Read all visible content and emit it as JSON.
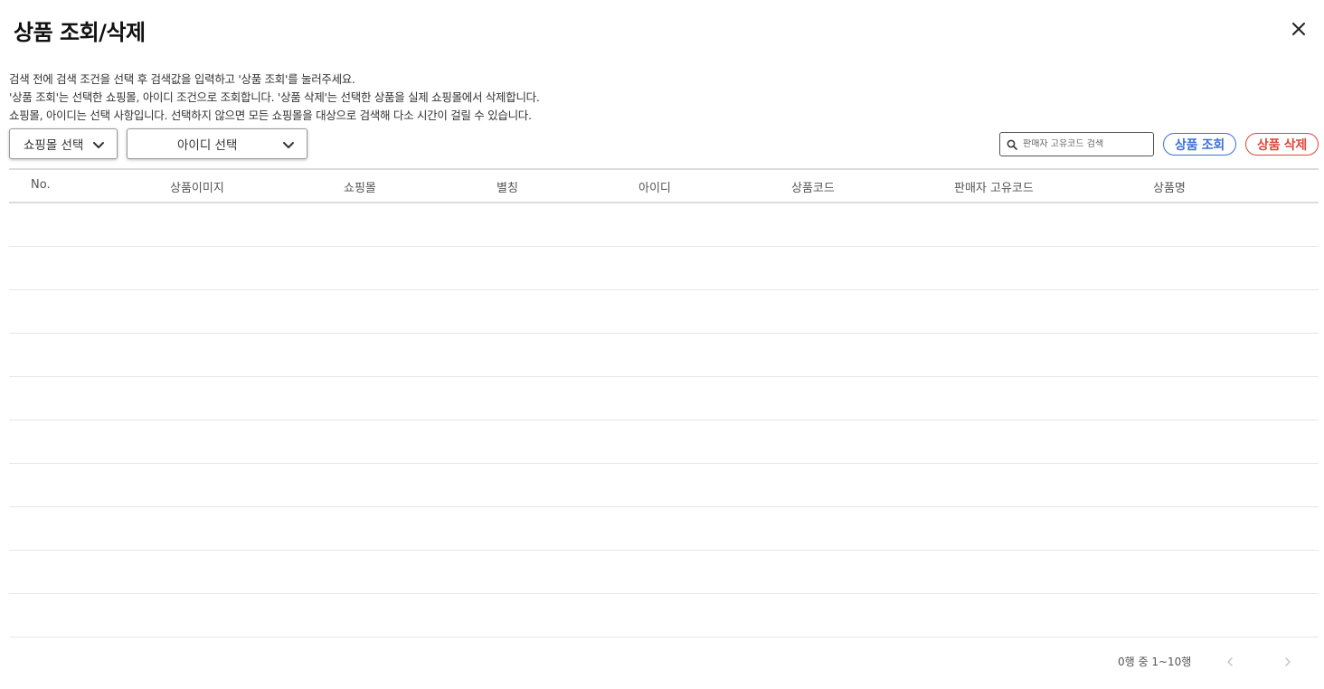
{
  "dialog": {
    "title": "상품 조회/삭제"
  },
  "instructions": [
    "검색 전에 검색 조건을 선택 후 검색값을 입력하고 '상품 조회'를 눌러주세요.",
    "'상품 조회'는 선택한 쇼핑몰, 아이디 조건으로 조회합니다. '상품 삭제'는 선택한 상품을 실제 쇼핑몰에서 삭제합니다.",
    "쇼핑몰, 아이디는 선택 사항입니다. 선택하지 않으면 모든 쇼핑몰을 대상으로 검색해 다소 시간이 걸릴 수 있습니다."
  ],
  "filters": {
    "mall_select": "쇼핑몰 선택",
    "id_select": "아이디 선택"
  },
  "search": {
    "placeholder": "판매자 고유코드 검색"
  },
  "actions": {
    "search_label": "상품 조회",
    "delete_label": "상품 삭제"
  },
  "table": {
    "columns": [
      "No.",
      "상품이미지",
      "쇼핑몰",
      "별칭",
      "아이디",
      "상품코드",
      "판매자 고유코드",
      "상품명"
    ]
  },
  "pagination": {
    "info": "0행 중 1~10행"
  },
  "colors": {
    "accent_blue": "#3c6fd8",
    "accent_red": "#e0463a"
  },
  "icons": {
    "close": "close-icon",
    "search": "search-icon",
    "dropdown": "chevron-down-icon",
    "prev": "chevron-left-icon",
    "next": "chevron-right-icon"
  }
}
